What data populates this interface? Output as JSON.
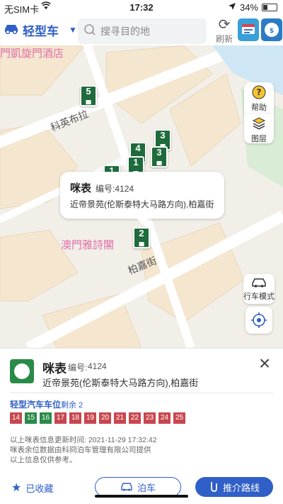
{
  "status_bar": {
    "carrier": "无SIM卡",
    "time": "17:32",
    "battery": "34%",
    "battery_level": 0.34
  },
  "top_bar": {
    "vehicle_type": "轻型车",
    "search_placeholder": "搜寻目的地",
    "refresh_label": "刷新"
  },
  "map": {
    "poi_labels": [
      "門凱旋門酒店",
      "澳門雅詩閣"
    ],
    "street_labels": [
      "科英布拉",
      "柏嘉街"
    ],
    "controls": {
      "help_label": "帮助",
      "layers_label": "图层",
      "drive_mode_label": "行车模式"
    },
    "markers": [
      {
        "number": "5"
      },
      {
        "number": "3"
      },
      {
        "number": "4"
      },
      {
        "number": "3"
      },
      {
        "number": "1"
      },
      {
        "number": "1"
      },
      {
        "number": "2"
      }
    ],
    "tooltip": {
      "title": "咪表",
      "code": "编号:4124",
      "address": "近帝景苑(伦斯泰特大马路方向),柏嘉街"
    }
  },
  "sheet": {
    "title": "咪表",
    "code_label": "编号:",
    "code": "4124",
    "address": "近帝景苑(伦斯泰特大马路方向),柏嘉街",
    "slot_section_label": "轻型汽车车位",
    "slot_remaining": "剩余 2",
    "slots": [
      {
        "number": "14",
        "status": "occupied"
      },
      {
        "number": "15",
        "status": "free"
      },
      {
        "number": "16",
        "status": "free"
      },
      {
        "number": "17",
        "status": "occupied"
      },
      {
        "number": "18",
        "status": "occupied"
      },
      {
        "number": "19",
        "status": "occupied"
      },
      {
        "number": "20",
        "status": "occupied"
      },
      {
        "number": "21",
        "status": "occupied"
      },
      {
        "number": "22",
        "status": "occupied"
      },
      {
        "number": "23",
        "status": "occupied"
      },
      {
        "number": "24",
        "status": "occupied"
      },
      {
        "number": "25",
        "status": "occupied"
      }
    ],
    "info_lines": [
      "以上咪表信息更新时间: 2021-11-29 17:32:42",
      "咪表余位数据由科冏泊车管理有限公司提供",
      "以上信息仅供参考。"
    ],
    "favorited_label": "已收藏",
    "park_button": "泊车",
    "route_button": "推介路线"
  },
  "colors": {
    "accent": "#2f5fc7",
    "slot_free": "#2a8a47",
    "slot_occupied": "#c8474f",
    "marker": "#1f6b3c"
  }
}
